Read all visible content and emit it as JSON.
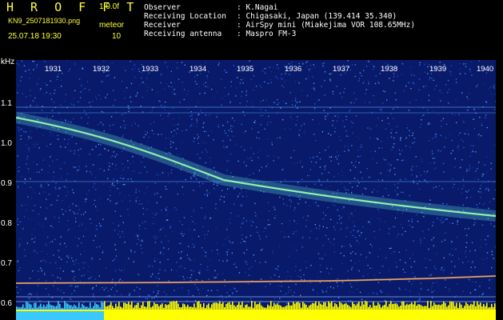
{
  "header": {
    "app_title": "H R O F F T",
    "version": "1.0.0f",
    "filename": "KN9_2507181930.png",
    "mode_label": "meteor",
    "datetime": "25.07.18 19:30",
    "number": "10",
    "info": [
      {
        "label": "Observer",
        "value": ": K.Nagai"
      },
      {
        "label": "Receiving Location",
        "value": ": Chigasaki, Japan (139.414 35.340)"
      },
      {
        "label": "Receiver",
        "value": ": AirSpy mini (Miakejima VOR 108.65MHz)"
      },
      {
        "label": "Receiving antenna",
        "value": ": Maspro FM-3"
      }
    ]
  },
  "plot": {
    "y_unit": "kHz",
    "y_ticks": [
      "1.1",
      "1.0",
      "0.9",
      "0.8",
      "0.7",
      "0.6"
    ],
    "x_ticks": [
      "1931",
      "1932",
      "1933",
      "1934",
      "1935",
      "1936",
      "1937",
      "1938",
      "1939",
      "1940"
    ],
    "colors": {
      "background": "#0a1a6a",
      "text_yellow": "#ffff3a",
      "noise_light": "#3a8cff",
      "trace": "#9cffb0",
      "carrier": "#ff6a3a",
      "power_bar": "#ffff00",
      "power_bar_start": "#39c8ff"
    }
  }
}
